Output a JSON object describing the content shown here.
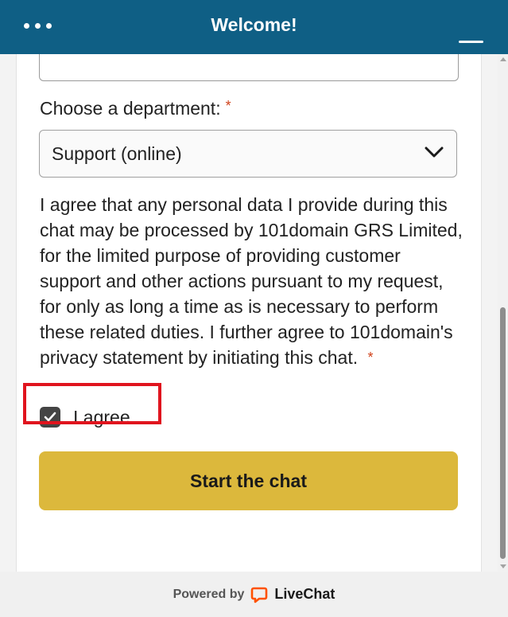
{
  "header": {
    "title": "Welcome!",
    "menu_icon": "more-horizontal-icon",
    "minimize_icon": "minimize-icon",
    "background": "#0f5f85"
  },
  "form": {
    "department_label": "Choose a department:",
    "required_mark": "*",
    "department_selected": "Support (online)",
    "consent_text": "I agree that any personal data I provide during this chat may be processed by 101domain GRS Limited, for the limited purpose of providing customer support and other actions pursuant to my request, for only as long a time as is necessary to perform these related duties. I further agree to 101domain's privacy statement by initiating this chat.",
    "agree_label": "I agree",
    "agree_checked": true,
    "start_button": "Start the chat",
    "button_color": "#dcb83c",
    "required_color": "#d0421b"
  },
  "footer": {
    "powered_by": "Powered by",
    "brand": "LiveChat",
    "brand_color": "#ff5100"
  }
}
